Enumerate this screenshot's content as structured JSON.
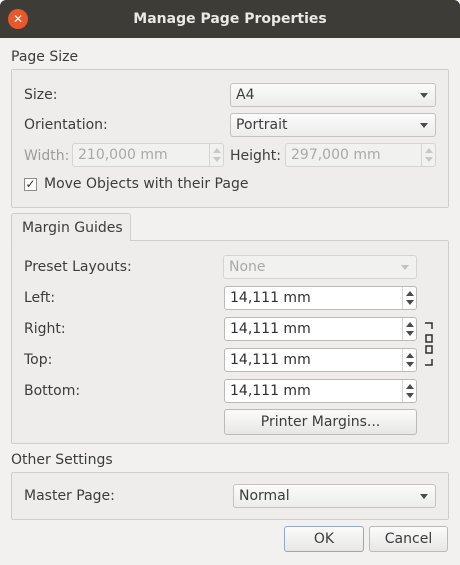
{
  "window": {
    "title": "Manage Page Properties",
    "close_glyph": "✕"
  },
  "page_size": {
    "heading": "Page Size",
    "size_label": "Size:",
    "size_value": "A4",
    "orientation_label": "Orientation:",
    "orientation_value": "Portrait",
    "width_label": "Width:",
    "width_value": "210,000 mm",
    "height_label": "Height:",
    "height_value": "297,000 mm",
    "move_objects_label": "Move Objects with their Page",
    "move_objects_checked": "✓"
  },
  "margin_guides": {
    "tab_label": "Margin Guides",
    "preset_label": "Preset Layouts:",
    "preset_value": "None",
    "left_label": "Left:",
    "left_value": "14,111 mm",
    "right_label": "Right:",
    "right_value": "14,111 mm",
    "top_label": "Top:",
    "top_value": "14,111 mm",
    "bottom_label": "Bottom:",
    "bottom_value": "14,111 mm",
    "printer_margins_label": "Printer Margins..."
  },
  "other_settings": {
    "heading": "Other Settings",
    "master_page_label": "Master Page:",
    "master_page_value": "Normal"
  },
  "footer": {
    "ok_label": "OK",
    "cancel_label": "Cancel"
  },
  "colors": {
    "titlebar": "#3d3c37",
    "close": "#e9582b",
    "dialog_bg": "#f2f1f0"
  },
  "icons": {
    "close": "close-icon",
    "chain": "chain-link-icon"
  }
}
